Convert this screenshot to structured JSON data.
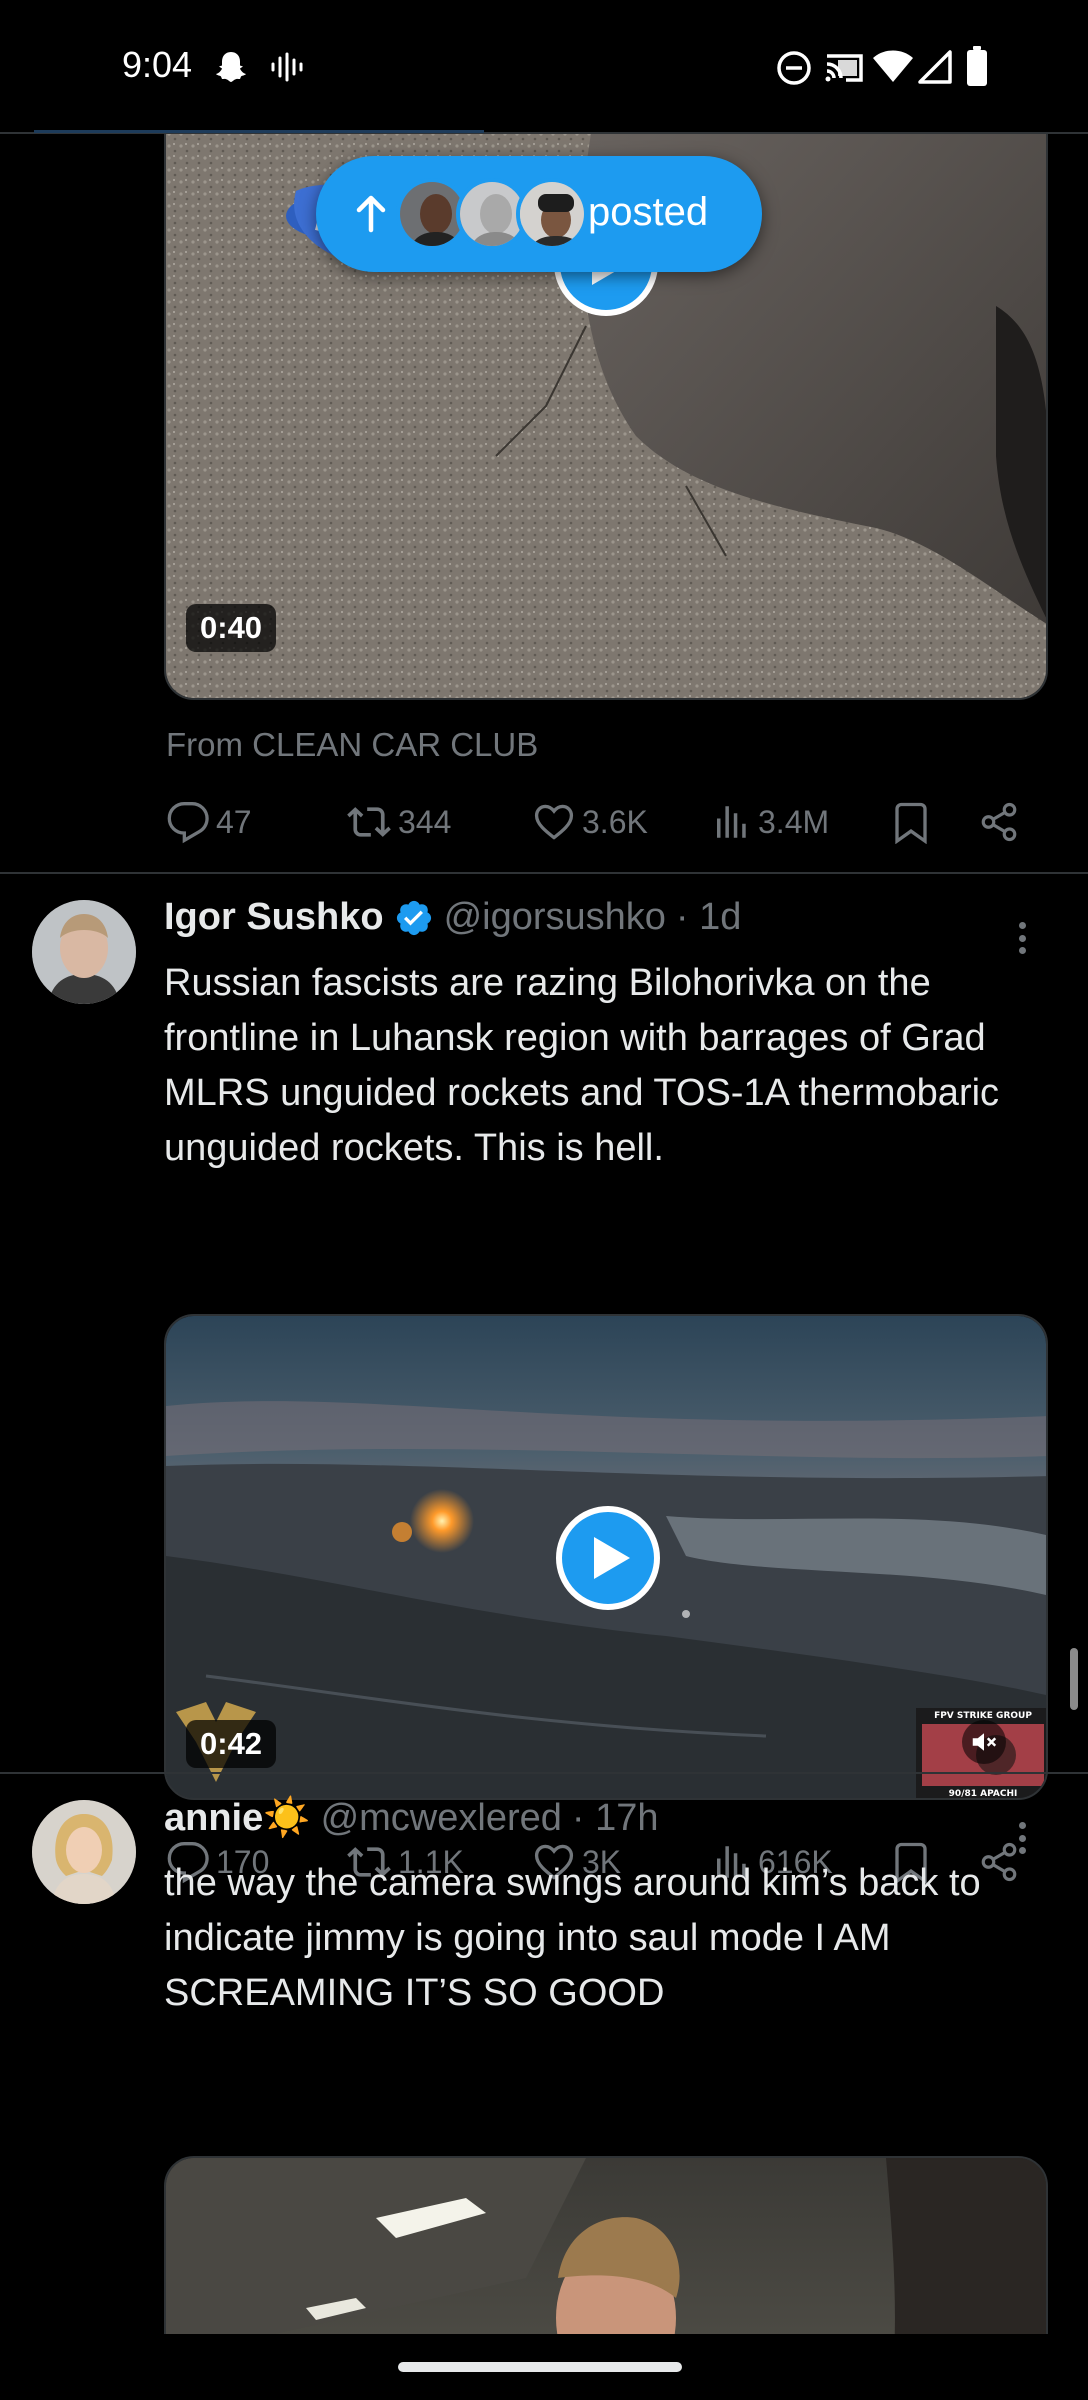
{
  "status_bar": {
    "time": "9:04",
    "left_icons": [
      "snapchat-icon",
      "voice-waveform-icon"
    ],
    "right_icons": [
      "do-not-disturb-icon",
      "cast-icon",
      "wifi-icon",
      "signal-icon",
      "battery-icon"
    ]
  },
  "posted_pill": {
    "label": "posted",
    "icon": "arrow-up-icon",
    "avatar_count": 3
  },
  "tweets": [
    {
      "video": {
        "duration": "0:40"
      },
      "from": {
        "prefix": "From",
        "source": "CLEAN CAR CLUB"
      },
      "metrics": {
        "replies": "47",
        "reposts": "344",
        "likes": "3.6K",
        "views": "3.4M"
      }
    },
    {
      "name": "Igor Sushko",
      "verified": true,
      "handle": "@igorsushko",
      "time": "· 1d",
      "text": "Russian fascists are razing Bilohorivka on the frontline in Luhansk region with barrages of Grad MLRS unguided rockets and TOS-1A thermobaric unguided rockets. This is hell.",
      "video": {
        "duration": "0:42",
        "watermark_top": "FPV STRIKE GROUP",
        "watermark_bottom": "90/81 APACHI"
      },
      "metrics": {
        "replies": "170",
        "reposts": "1.1K",
        "likes": "3K",
        "views": "616K"
      }
    },
    {
      "name": "annie☀️",
      "handle": "@mcwexlered",
      "time": "· 17h",
      "text": "the way the camera swings around kim’s back to indicate jimmy is going into saul mode I AM SCREAMING IT’S SO GOOD",
      "video": {}
    }
  ],
  "colors": {
    "background": "#000000",
    "text": "#e7e9ea",
    "secondary": "#71767b",
    "accent": "#1d9bf0",
    "divider": "#2f3336"
  }
}
